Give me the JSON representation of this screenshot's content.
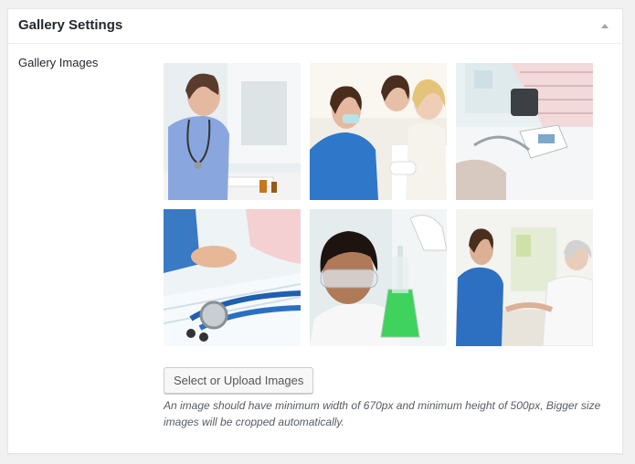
{
  "metabox": {
    "title": "Gallery Settings",
    "toggle_icon": "triangle-up-icon"
  },
  "field": {
    "label": "Gallery Images"
  },
  "gallery": {
    "images": [
      {
        "name": "nurse-at-computer"
      },
      {
        "name": "nurse-with-child-patient"
      },
      {
        "name": "blood-pressure-monitor"
      },
      {
        "name": "stethoscope-on-desk"
      },
      {
        "name": "lab-researcher-flask"
      },
      {
        "name": "nurse-with-elderly-patient"
      }
    ]
  },
  "actions": {
    "upload_label": "Select or Upload Images",
    "help_text": "An image should have minimum width of 670px and minimum height of 500px, Bigger size images will be cropped automatically."
  },
  "colors": {
    "scrub_blue": "#2a6fc4",
    "lab_green": "#3fd25c",
    "panel_border": "#e5e5e5"
  }
}
